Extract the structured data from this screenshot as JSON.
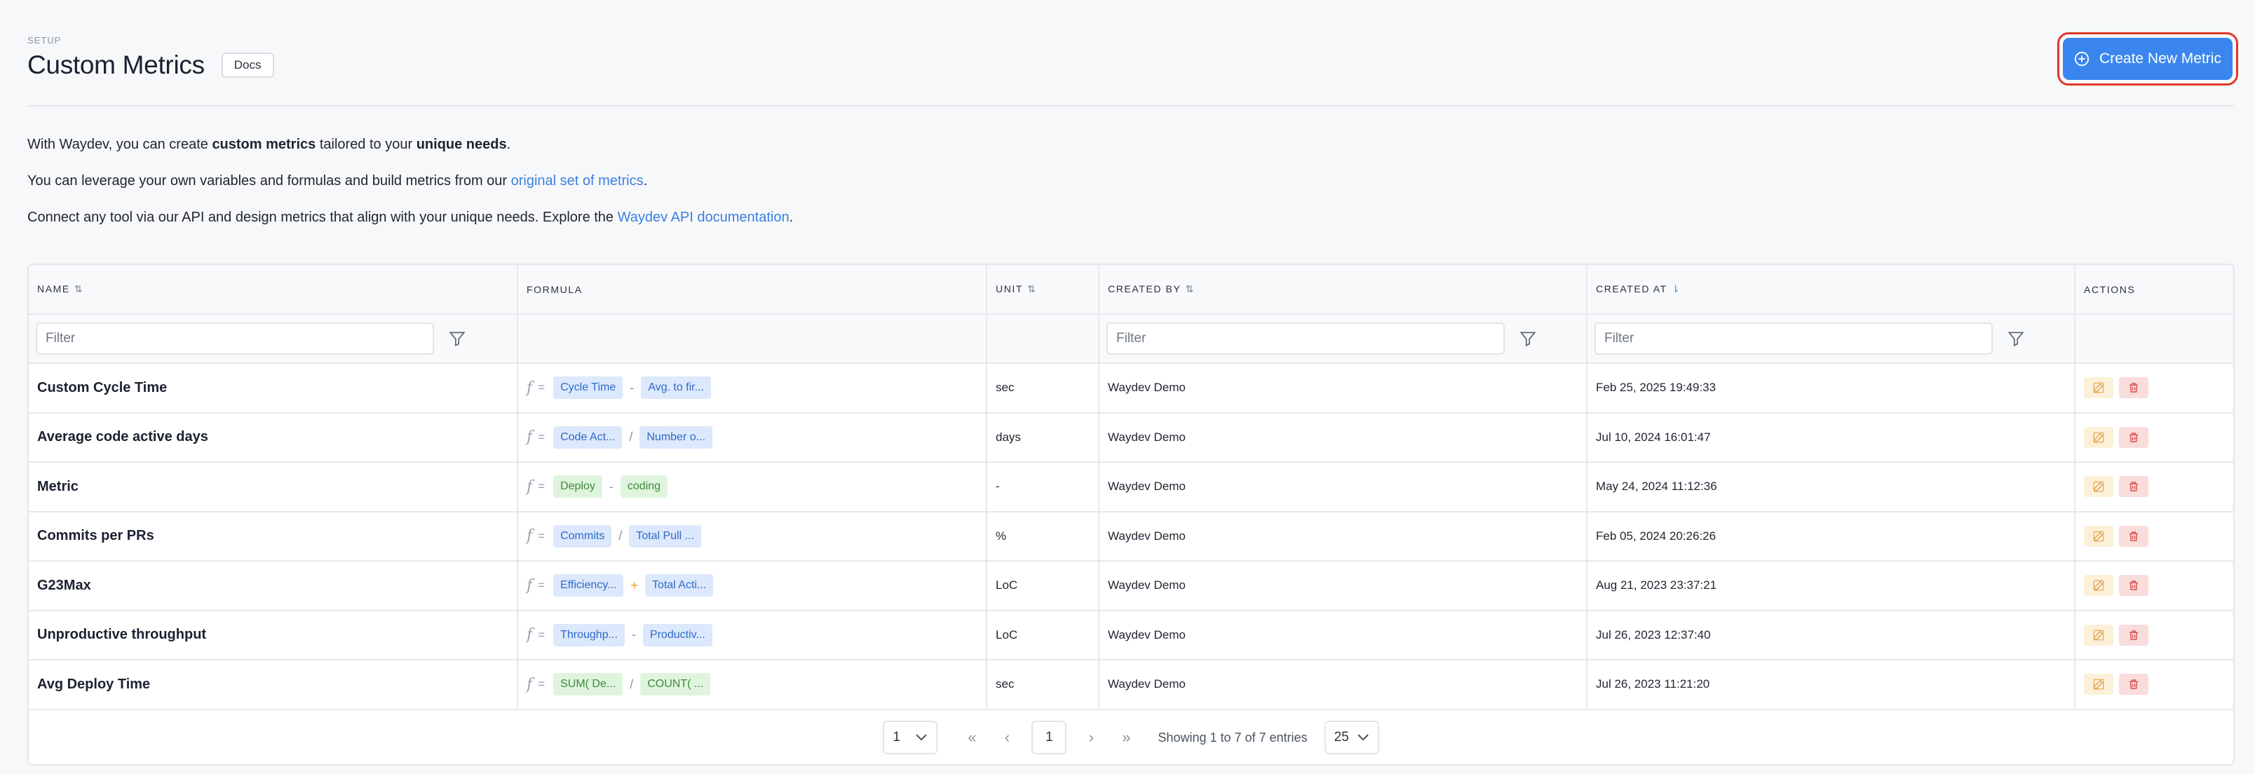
{
  "header": {
    "eyebrow": "SETUP",
    "title": "Custom Metrics",
    "docs_label": "Docs",
    "create_label": "Create New Metric"
  },
  "intro": {
    "p1_a": "With Waydev, you can create ",
    "p1_b": "custom metrics",
    "p1_c": " tailored to your ",
    "p1_d": "unique needs",
    "p1_e": ".",
    "p2_a": "You can leverage your own variables and formulas and build metrics from our ",
    "p2_link": "original set of metrics",
    "p2_b": ".",
    "p3_a": "Connect any tool via our API and design metrics that align with your unique needs. Explore the ",
    "p3_link": "Waydev API documentation",
    "p3_b": "."
  },
  "table": {
    "columns": {
      "name": "NAME",
      "formula": "FORMULA",
      "unit": "UNIT",
      "created_by": "CREATED BY",
      "created_at": "CREATED AT",
      "actions": "ACTIONS"
    },
    "filter_placeholder": "Filter",
    "rows": [
      {
        "name": "Custom Cycle Time",
        "a": "Cycle Time",
        "op": "-",
        "b": "Avg. to fir...",
        "unit": "sec",
        "by": "Waydev Demo",
        "at": "Feb 25, 2025 19:49:33"
      },
      {
        "name": "Average code active days",
        "a": "Code Act...",
        "op": "/",
        "b": "Number o...",
        "unit": "days",
        "by": "Waydev Demo",
        "at": "Jul 10, 2024 16:01:47"
      },
      {
        "name": "Metric",
        "a": "Deploy",
        "op": "-",
        "b": "coding",
        "unit": "-",
        "by": "Waydev Demo",
        "at": "May 24, 2024 11:12:36"
      },
      {
        "name": "Commits per PRs",
        "a": "Commits",
        "op": "/",
        "b": "Total Pull ...",
        "unit": "%",
        "by": "Waydev Demo",
        "at": "Feb 05, 2024 20:26:26"
      },
      {
        "name": "G23Max",
        "a": "Efficiency...",
        "op": "+",
        "b": "Total Acti...",
        "unit": "LoC",
        "by": "Waydev Demo",
        "at": "Aug 21, 2023 23:37:21"
      },
      {
        "name": "Unproductive throughput",
        "a": "Throughp...",
        "op": "-",
        "b": "Productiv...",
        "unit": "LoC",
        "by": "Waydev Demo",
        "at": "Jul 26, 2023 12:37:40"
      },
      {
        "name": "Avg Deploy Time",
        "a": "SUM( De...",
        "op": "/",
        "b": "COUNT( ...",
        "unit": "sec",
        "by": "Waydev Demo",
        "at": "Jul 26, 2023 11:21:20"
      }
    ],
    "formula_symbol": "f",
    "formula_eq": "="
  },
  "pagination": {
    "page_select": "1",
    "first": "«",
    "prev": "‹",
    "current": "1",
    "next": "›",
    "last": "»",
    "showing": "Showing 1 to 7 of 7 entries",
    "per_page": "25"
  },
  "colors": {
    "accent": "#3a86ee",
    "highlight": "#e0392b",
    "chip_blue": "#dce8fb",
    "chip_green": "#dff4dd"
  }
}
